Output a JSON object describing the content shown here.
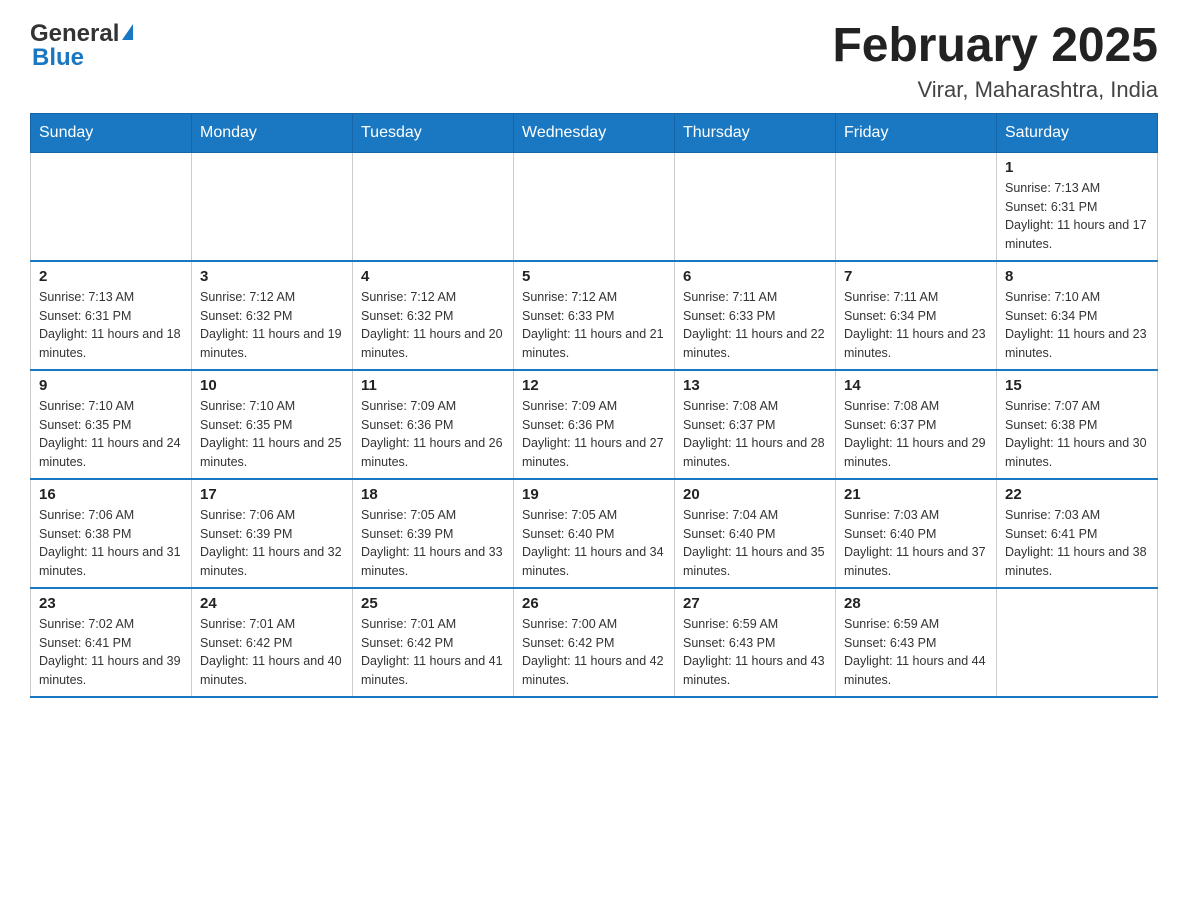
{
  "header": {
    "logo_general": "General",
    "logo_blue": "Blue",
    "title": "February 2025",
    "subtitle": "Virar, Maharashtra, India"
  },
  "weekdays": [
    "Sunday",
    "Monday",
    "Tuesday",
    "Wednesday",
    "Thursday",
    "Friday",
    "Saturday"
  ],
  "weeks": [
    [
      {
        "day": "",
        "sunrise": "",
        "sunset": "",
        "daylight": ""
      },
      {
        "day": "",
        "sunrise": "",
        "sunset": "",
        "daylight": ""
      },
      {
        "day": "",
        "sunrise": "",
        "sunset": "",
        "daylight": ""
      },
      {
        "day": "",
        "sunrise": "",
        "sunset": "",
        "daylight": ""
      },
      {
        "day": "",
        "sunrise": "",
        "sunset": "",
        "daylight": ""
      },
      {
        "day": "",
        "sunrise": "",
        "sunset": "",
        "daylight": ""
      },
      {
        "day": "1",
        "sunrise": "Sunrise: 7:13 AM",
        "sunset": "Sunset: 6:31 PM",
        "daylight": "Daylight: 11 hours and 17 minutes."
      }
    ],
    [
      {
        "day": "2",
        "sunrise": "Sunrise: 7:13 AM",
        "sunset": "Sunset: 6:31 PM",
        "daylight": "Daylight: 11 hours and 18 minutes."
      },
      {
        "day": "3",
        "sunrise": "Sunrise: 7:12 AM",
        "sunset": "Sunset: 6:32 PM",
        "daylight": "Daylight: 11 hours and 19 minutes."
      },
      {
        "day": "4",
        "sunrise": "Sunrise: 7:12 AM",
        "sunset": "Sunset: 6:32 PM",
        "daylight": "Daylight: 11 hours and 20 minutes."
      },
      {
        "day": "5",
        "sunrise": "Sunrise: 7:12 AM",
        "sunset": "Sunset: 6:33 PM",
        "daylight": "Daylight: 11 hours and 21 minutes."
      },
      {
        "day": "6",
        "sunrise": "Sunrise: 7:11 AM",
        "sunset": "Sunset: 6:33 PM",
        "daylight": "Daylight: 11 hours and 22 minutes."
      },
      {
        "day": "7",
        "sunrise": "Sunrise: 7:11 AM",
        "sunset": "Sunset: 6:34 PM",
        "daylight": "Daylight: 11 hours and 23 minutes."
      },
      {
        "day": "8",
        "sunrise": "Sunrise: 7:10 AM",
        "sunset": "Sunset: 6:34 PM",
        "daylight": "Daylight: 11 hours and 23 minutes."
      }
    ],
    [
      {
        "day": "9",
        "sunrise": "Sunrise: 7:10 AM",
        "sunset": "Sunset: 6:35 PM",
        "daylight": "Daylight: 11 hours and 24 minutes."
      },
      {
        "day": "10",
        "sunrise": "Sunrise: 7:10 AM",
        "sunset": "Sunset: 6:35 PM",
        "daylight": "Daylight: 11 hours and 25 minutes."
      },
      {
        "day": "11",
        "sunrise": "Sunrise: 7:09 AM",
        "sunset": "Sunset: 6:36 PM",
        "daylight": "Daylight: 11 hours and 26 minutes."
      },
      {
        "day": "12",
        "sunrise": "Sunrise: 7:09 AM",
        "sunset": "Sunset: 6:36 PM",
        "daylight": "Daylight: 11 hours and 27 minutes."
      },
      {
        "day": "13",
        "sunrise": "Sunrise: 7:08 AM",
        "sunset": "Sunset: 6:37 PM",
        "daylight": "Daylight: 11 hours and 28 minutes."
      },
      {
        "day": "14",
        "sunrise": "Sunrise: 7:08 AM",
        "sunset": "Sunset: 6:37 PM",
        "daylight": "Daylight: 11 hours and 29 minutes."
      },
      {
        "day": "15",
        "sunrise": "Sunrise: 7:07 AM",
        "sunset": "Sunset: 6:38 PM",
        "daylight": "Daylight: 11 hours and 30 minutes."
      }
    ],
    [
      {
        "day": "16",
        "sunrise": "Sunrise: 7:06 AM",
        "sunset": "Sunset: 6:38 PM",
        "daylight": "Daylight: 11 hours and 31 minutes."
      },
      {
        "day": "17",
        "sunrise": "Sunrise: 7:06 AM",
        "sunset": "Sunset: 6:39 PM",
        "daylight": "Daylight: 11 hours and 32 minutes."
      },
      {
        "day": "18",
        "sunrise": "Sunrise: 7:05 AM",
        "sunset": "Sunset: 6:39 PM",
        "daylight": "Daylight: 11 hours and 33 minutes."
      },
      {
        "day": "19",
        "sunrise": "Sunrise: 7:05 AM",
        "sunset": "Sunset: 6:40 PM",
        "daylight": "Daylight: 11 hours and 34 minutes."
      },
      {
        "day": "20",
        "sunrise": "Sunrise: 7:04 AM",
        "sunset": "Sunset: 6:40 PM",
        "daylight": "Daylight: 11 hours and 35 minutes."
      },
      {
        "day": "21",
        "sunrise": "Sunrise: 7:03 AM",
        "sunset": "Sunset: 6:40 PM",
        "daylight": "Daylight: 11 hours and 37 minutes."
      },
      {
        "day": "22",
        "sunrise": "Sunrise: 7:03 AM",
        "sunset": "Sunset: 6:41 PM",
        "daylight": "Daylight: 11 hours and 38 minutes."
      }
    ],
    [
      {
        "day": "23",
        "sunrise": "Sunrise: 7:02 AM",
        "sunset": "Sunset: 6:41 PM",
        "daylight": "Daylight: 11 hours and 39 minutes."
      },
      {
        "day": "24",
        "sunrise": "Sunrise: 7:01 AM",
        "sunset": "Sunset: 6:42 PM",
        "daylight": "Daylight: 11 hours and 40 minutes."
      },
      {
        "day": "25",
        "sunrise": "Sunrise: 7:01 AM",
        "sunset": "Sunset: 6:42 PM",
        "daylight": "Daylight: 11 hours and 41 minutes."
      },
      {
        "day": "26",
        "sunrise": "Sunrise: 7:00 AM",
        "sunset": "Sunset: 6:42 PM",
        "daylight": "Daylight: 11 hours and 42 minutes."
      },
      {
        "day": "27",
        "sunrise": "Sunrise: 6:59 AM",
        "sunset": "Sunset: 6:43 PM",
        "daylight": "Daylight: 11 hours and 43 minutes."
      },
      {
        "day": "28",
        "sunrise": "Sunrise: 6:59 AM",
        "sunset": "Sunset: 6:43 PM",
        "daylight": "Daylight: 11 hours and 44 minutes."
      },
      {
        "day": "",
        "sunrise": "",
        "sunset": "",
        "daylight": ""
      }
    ]
  ]
}
